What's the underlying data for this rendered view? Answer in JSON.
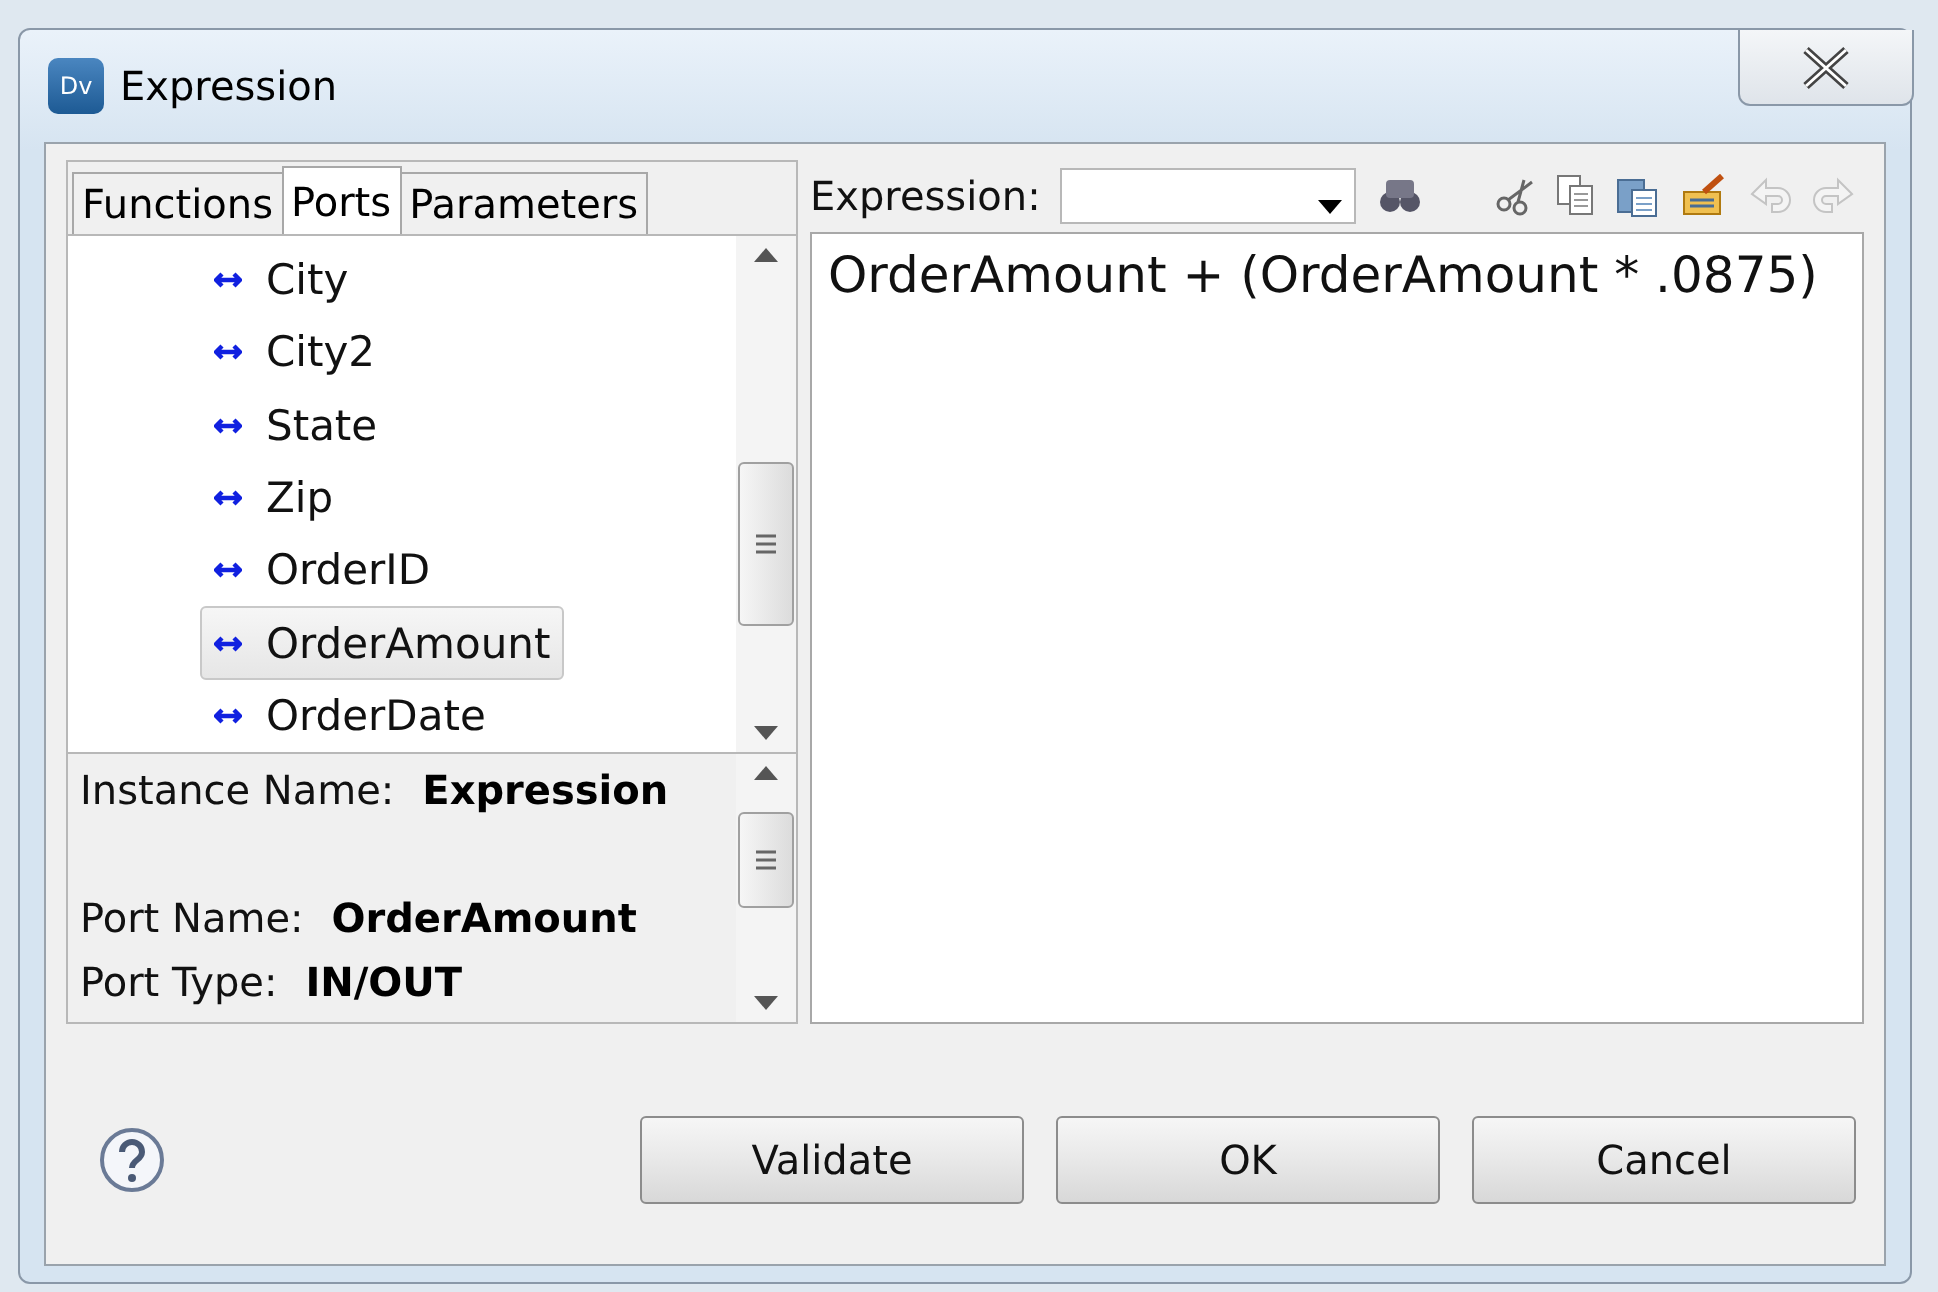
{
  "window": {
    "title": "Expression",
    "app_badge": "Dv"
  },
  "tabs": [
    {
      "label": "Functions",
      "selected": false
    },
    {
      "label": "Ports",
      "selected": true
    },
    {
      "label": "Parameters",
      "selected": false
    }
  ],
  "ports": [
    {
      "name": "City",
      "selected": false
    },
    {
      "name": "City2",
      "selected": false
    },
    {
      "name": "State",
      "selected": false
    },
    {
      "name": "Zip",
      "selected": false
    },
    {
      "name": "OrderID",
      "selected": false
    },
    {
      "name": "OrderAmount",
      "selected": true
    },
    {
      "name": "OrderDate",
      "selected": false
    }
  ],
  "details": [
    {
      "label": "Instance Name:",
      "value": "Expression"
    },
    {
      "label": "Port Name:",
      "value": "OrderAmount"
    },
    {
      "label": "Port Type:",
      "value": "IN/OUT"
    }
  ],
  "editor": {
    "label": "Expression:",
    "text": "OrderAmount + (OrderAmount * .0875)"
  },
  "buttons": [
    "Validate",
    "OK",
    "Cancel"
  ]
}
